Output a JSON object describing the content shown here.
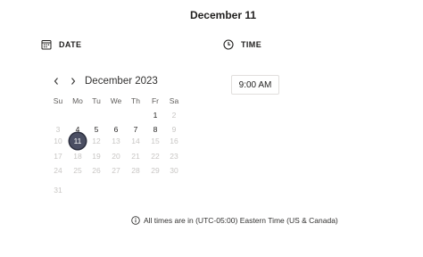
{
  "header": {
    "title": "December 11"
  },
  "date_section": {
    "label": "DATE",
    "icon": "calendar-icon",
    "month_label": "December 2023",
    "prev_icon": "chevron-left-icon",
    "next_icon": "chevron-right-icon",
    "weekdays": [
      "Su",
      "Mo",
      "Tu",
      "We",
      "Th",
      "Fr",
      "Sa"
    ],
    "weeks": [
      [
        {
          "d": ""
        },
        {
          "d": ""
        },
        {
          "d": ""
        },
        {
          "d": ""
        },
        {
          "d": ""
        },
        {
          "d": "1",
          "s": "enabled"
        },
        {
          "d": "2",
          "s": "disabled"
        }
      ],
      [
        {
          "d": "3",
          "s": "disabled"
        },
        {
          "d": "4",
          "s": "enabled"
        },
        {
          "d": "5",
          "s": "enabled"
        },
        {
          "d": "6",
          "s": "enabled"
        },
        {
          "d": "7",
          "s": "enabled"
        },
        {
          "d": "8",
          "s": "enabled"
        },
        {
          "d": "9",
          "s": "disabled"
        }
      ],
      [
        {
          "d": "10",
          "s": "disabled"
        },
        {
          "d": "11",
          "s": "selected"
        },
        {
          "d": "12",
          "s": "disabled"
        },
        {
          "d": "13",
          "s": "disabled"
        },
        {
          "d": "14",
          "s": "disabled"
        },
        {
          "d": "15",
          "s": "disabled"
        },
        {
          "d": "16",
          "s": "disabled"
        }
      ],
      [
        {
          "d": "17",
          "s": "disabled"
        },
        {
          "d": "18",
          "s": "disabled"
        },
        {
          "d": "19",
          "s": "disabled"
        },
        {
          "d": "20",
          "s": "disabled"
        },
        {
          "d": "21",
          "s": "disabled"
        },
        {
          "d": "22",
          "s": "disabled"
        },
        {
          "d": "23",
          "s": "disabled"
        }
      ],
      [
        {
          "d": "24",
          "s": "disabled"
        },
        {
          "d": "25",
          "s": "disabled"
        },
        {
          "d": "26",
          "s": "disabled"
        },
        {
          "d": "27",
          "s": "disabled"
        },
        {
          "d": "28",
          "s": "disabled"
        },
        {
          "d": "29",
          "s": "disabled"
        },
        {
          "d": "30",
          "s": "disabled"
        }
      ],
      [
        {
          "d": "31",
          "s": "disabled"
        },
        {
          "d": ""
        },
        {
          "d": ""
        },
        {
          "d": ""
        },
        {
          "d": ""
        },
        {
          "d": ""
        },
        {
          "d": ""
        }
      ]
    ]
  },
  "time_section": {
    "label": "TIME",
    "icon": "clock-icon",
    "slots": [
      "9:00 AM"
    ]
  },
  "timezone": {
    "icon": "info-icon",
    "text": "All times are in (UTC-05:00) Eastern Time (US & Canada)"
  },
  "colors": {
    "selected_day_bg": "#4b4f63",
    "disabled_text": "#c8c6c4",
    "text": "#201f1e"
  }
}
